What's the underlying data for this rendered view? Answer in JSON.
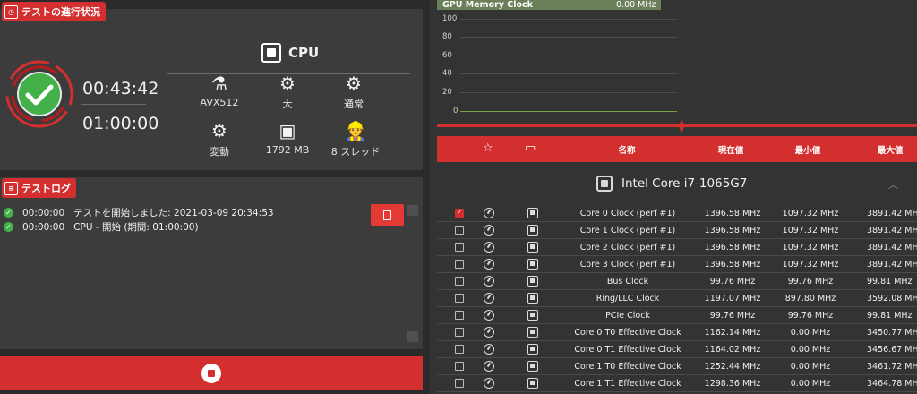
{
  "progress": {
    "title": "テストの進行状況",
    "elapsed": "00:43:42",
    "total": "01:00:00",
    "status": "passed"
  },
  "cpu": {
    "label": "CPU",
    "params": [
      {
        "icon": "flask-icon",
        "label": "AVX512"
      },
      {
        "icon": "gears-icon",
        "label": "大"
      },
      {
        "icon": "gears-icon",
        "label": "通常"
      },
      {
        "icon": "gears-icon",
        "label": "変動"
      },
      {
        "icon": "chip-icon",
        "label": "1792 MB"
      },
      {
        "icon": "worker-icon",
        "label": "8 スレッド"
      }
    ]
  },
  "log": {
    "title": "テストログ",
    "entries": [
      {
        "time": "00:00:00",
        "message": "テストを開始しました: 2021-03-09 20:34:53"
      },
      {
        "time": "00:00:00",
        "message": "CPU - 開始 (期間: 01:00:00)"
      }
    ]
  },
  "graph": {
    "title": "GPU Memory Clock",
    "value": "0.00 MHz",
    "ticks": [
      "100",
      "80",
      "60",
      "40",
      "20",
      "0"
    ]
  },
  "table": {
    "headers": {
      "name": "名称",
      "current": "現在値",
      "min": "最小値",
      "max": "最大値"
    },
    "group": "Intel Core i7-1065G7",
    "rows": [
      {
        "checked": true,
        "name": "Core 0 Clock (perf #1)",
        "current": "1396.58 MHz",
        "min": "1097.32 MHz",
        "max": "3891.42 MHz"
      },
      {
        "checked": false,
        "name": "Core 1 Clock (perf #1)",
        "current": "1396.58 MHz",
        "min": "1097.32 MHz",
        "max": "3891.42 MHz"
      },
      {
        "checked": false,
        "name": "Core 2 Clock (perf #1)",
        "current": "1396.58 MHz",
        "min": "1097.32 MHz",
        "max": "3891.42 MHz"
      },
      {
        "checked": false,
        "name": "Core 3 Clock (perf #1)",
        "current": "1396.58 MHz",
        "min": "1097.32 MHz",
        "max": "3891.42 MHz"
      },
      {
        "checked": false,
        "name": "Bus Clock",
        "current": "99.76 MHz",
        "min": "99.76 MHz",
        "max": "99.81 MHz"
      },
      {
        "checked": false,
        "name": "Ring/LLC Clock",
        "current": "1197.07 MHz",
        "min": "897.80 MHz",
        "max": "3592.08 MHz"
      },
      {
        "checked": false,
        "name": "PCIe Clock",
        "current": "99.76 MHz",
        "min": "99.76 MHz",
        "max": "99.81 MHz"
      },
      {
        "checked": false,
        "name": "Core 0 T0 Effective Clock",
        "current": "1162.14 MHz",
        "min": "0.00 MHz",
        "max": "3450.77 MHz"
      },
      {
        "checked": false,
        "name": "Core 0 T1 Effective Clock",
        "current": "1164.02 MHz",
        "min": "0.00 MHz",
        "max": "3456.67 MHz"
      },
      {
        "checked": false,
        "name": "Core 1 T0 Effective Clock",
        "current": "1252.44 MHz",
        "min": "0.00 MHz",
        "max": "3461.72 MHz"
      },
      {
        "checked": false,
        "name": "Core 1 T1 Effective Clock",
        "current": "1298.36 MHz",
        "min": "0.00 MHz",
        "max": "3464.78 MHz"
      }
    ]
  },
  "colors": {
    "accent": "#d32f2f",
    "success": "#43b049",
    "graph_line": "#7da04d"
  }
}
